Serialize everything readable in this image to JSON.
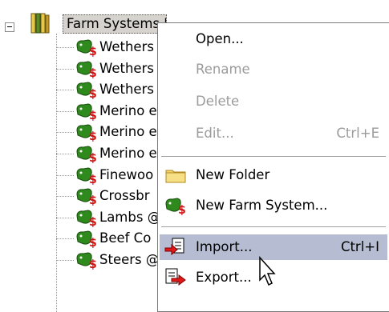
{
  "tree": {
    "root_label": "Farm Systems Library",
    "items": [
      "Wethers",
      "Wethers",
      "Wethers",
      "Merino e",
      "Merino e",
      "Merino e",
      "Finewoo",
      "Crossbr",
      "Lambs @",
      "Beef Co",
      "Steers @ Glen Innes NSW"
    ]
  },
  "menu": {
    "open": "Open...",
    "rename": "Rename",
    "delete": "Delete",
    "edit": "Edit...",
    "edit_shortcut": "Ctrl+E",
    "new_folder": "New Folder",
    "new_farm_system": "New Farm System...",
    "import": "Import...",
    "import_shortcut": "Ctrl+I",
    "export": "Export..."
  },
  "colors": {
    "selection": "#b6bdd2",
    "disabled_text": "#9b9b9b"
  }
}
